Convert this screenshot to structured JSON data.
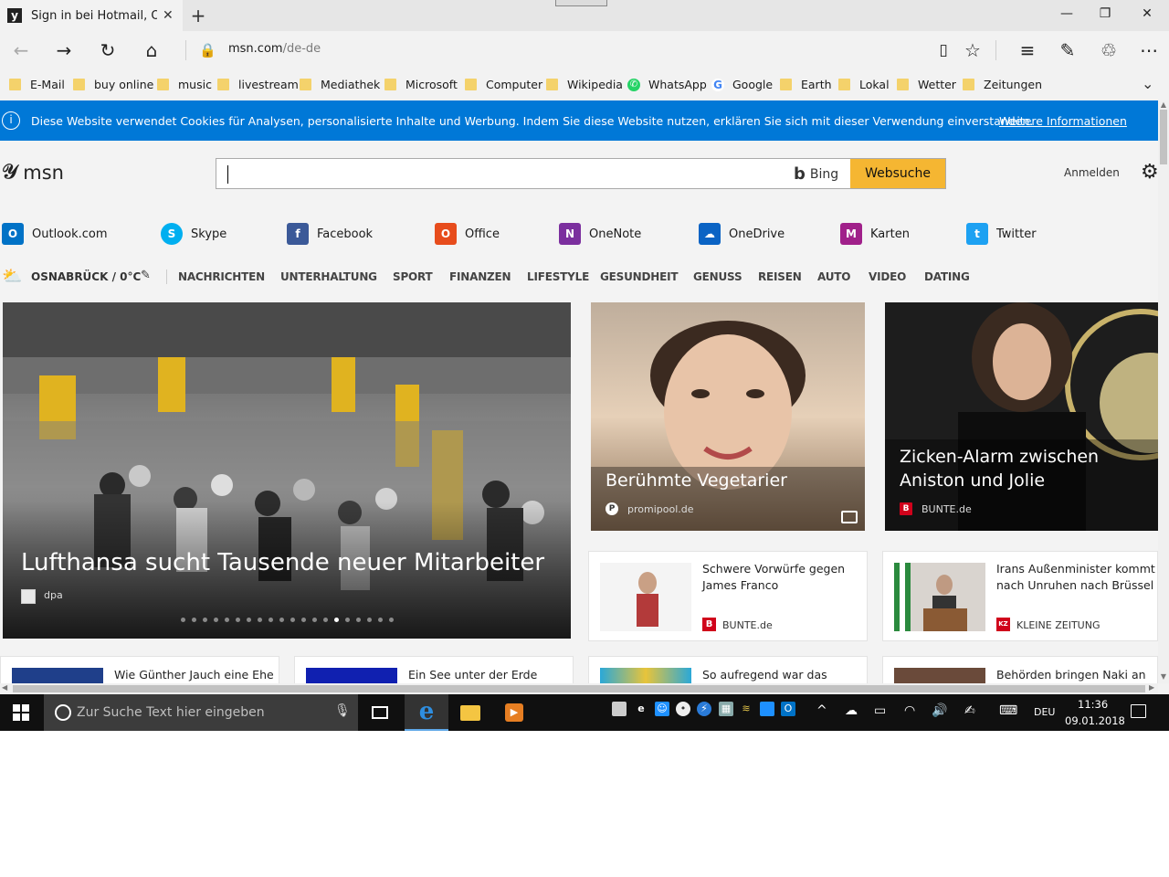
{
  "browser": {
    "tab_title": "Sign in bei Hotmail, Out",
    "tab_favicon": "msn-logo-icon",
    "url_domain": "msn.com",
    "url_path": "/de-de"
  },
  "favorites": [
    {
      "label": "E-Mail",
      "icon": "folder"
    },
    {
      "label": "buy online",
      "icon": "folder"
    },
    {
      "label": "music",
      "icon": "folder"
    },
    {
      "label": "livestream",
      "icon": "folder"
    },
    {
      "label": "Mediathek",
      "icon": "folder"
    },
    {
      "label": "Microsoft",
      "icon": "folder"
    },
    {
      "label": "Computer",
      "icon": "folder"
    },
    {
      "label": "Wikipedia",
      "icon": "folder"
    },
    {
      "label": "WhatsApp",
      "icon": "whatsapp",
      "color": "#25d366"
    },
    {
      "label": "Google",
      "icon": "google",
      "color": "#4285f4"
    },
    {
      "label": "Earth",
      "icon": "folder"
    },
    {
      "label": "Lokal",
      "icon": "folder"
    },
    {
      "label": "Wetter",
      "icon": "folder"
    },
    {
      "label": "Zeitungen",
      "icon": "folder"
    }
  ],
  "cookie_banner": {
    "text": "Diese Website verwendet Cookies für Analysen, personalisierte Inhalte und Werbung. Indem Sie diese Website nutzen, erklären Sie sich mit dieser Verwendung einverstanden.",
    "link": "Weitere Informationen",
    "color": "#0078d7"
  },
  "header": {
    "logo": "msn",
    "search_value": "",
    "bing_label": "Bing",
    "search_button": "Websuche",
    "signin": "Anmelden",
    "accent": "#f5b632"
  },
  "quick_links": [
    {
      "label": "Outlook.com",
      "icon": "outlook-icon",
      "color": "#0072c6",
      "glyph": "O"
    },
    {
      "label": "Skype",
      "icon": "skype-icon",
      "color": "#00aff0",
      "glyph": "S"
    },
    {
      "label": "Facebook",
      "icon": "facebook-icon",
      "color": "#3b5998",
      "glyph": "f"
    },
    {
      "label": "Office",
      "icon": "office-icon",
      "color": "#e74c1c",
      "glyph": "O"
    },
    {
      "label": "OneNote",
      "icon": "onenote-icon",
      "color": "#7b2f9e",
      "glyph": "N"
    },
    {
      "label": "OneDrive",
      "icon": "onedrive-icon",
      "color": "#0a63c4",
      "glyph": "☁"
    },
    {
      "label": "Karten",
      "icon": "maps-icon",
      "color": "#a0208a",
      "glyph": "M"
    },
    {
      "label": "Twitter",
      "icon": "twitter-icon",
      "color": "#1da1f2",
      "glyph": "t"
    }
  ],
  "categories": {
    "location": "OSNABRÜCK / 0°C",
    "items": [
      "NACHRICHTEN",
      "UNTERHALTUNG",
      "SPORT",
      "FINANZEN",
      "LIFESTYLE",
      "GESUNDHEIT",
      "GENUSS",
      "REISEN",
      "AUTO",
      "VIDEO",
      "DATING"
    ]
  },
  "hero": {
    "title": "Lufthansa sucht Tausende neuer Mitarbeiter",
    "source": "dpa",
    "dots_total": 20,
    "dot_active_index": 14
  },
  "tiles": [
    {
      "title": "Berühmte Vegetarier",
      "source": "promipool.de",
      "src_icon": "P"
    },
    {
      "title_line1": "Zicken-Alarm zwischen",
      "title_line2": "Aniston und Jolie",
      "source": "BUNTE.de",
      "src_icon": "B"
    }
  ],
  "cards": [
    {
      "title": "Schwere Vorwürfe gegen James Franco",
      "source": "BUNTE.de",
      "src_icon": "B",
      "src_color": "#d0021b"
    },
    {
      "title": "Irans Außenminister kommt nach Unruhen nach Brüssel",
      "source": "KLEINE ZEITUNG",
      "src_icon": "KZ",
      "src_color": "#d0021b"
    }
  ],
  "bottom_cards": [
    {
      "title": "Wie Günther Jauch eine Ehe"
    },
    {
      "title": "Ein See unter der Erde"
    },
    {
      "title": "So aufregend war das"
    },
    {
      "title": "Behörden bringen Naki an"
    }
  ],
  "taskbar": {
    "search_placeholder": "Zur Suche Text hier eingeben",
    "language": "DEU",
    "time": "11:36",
    "date": "09.01.2018"
  }
}
